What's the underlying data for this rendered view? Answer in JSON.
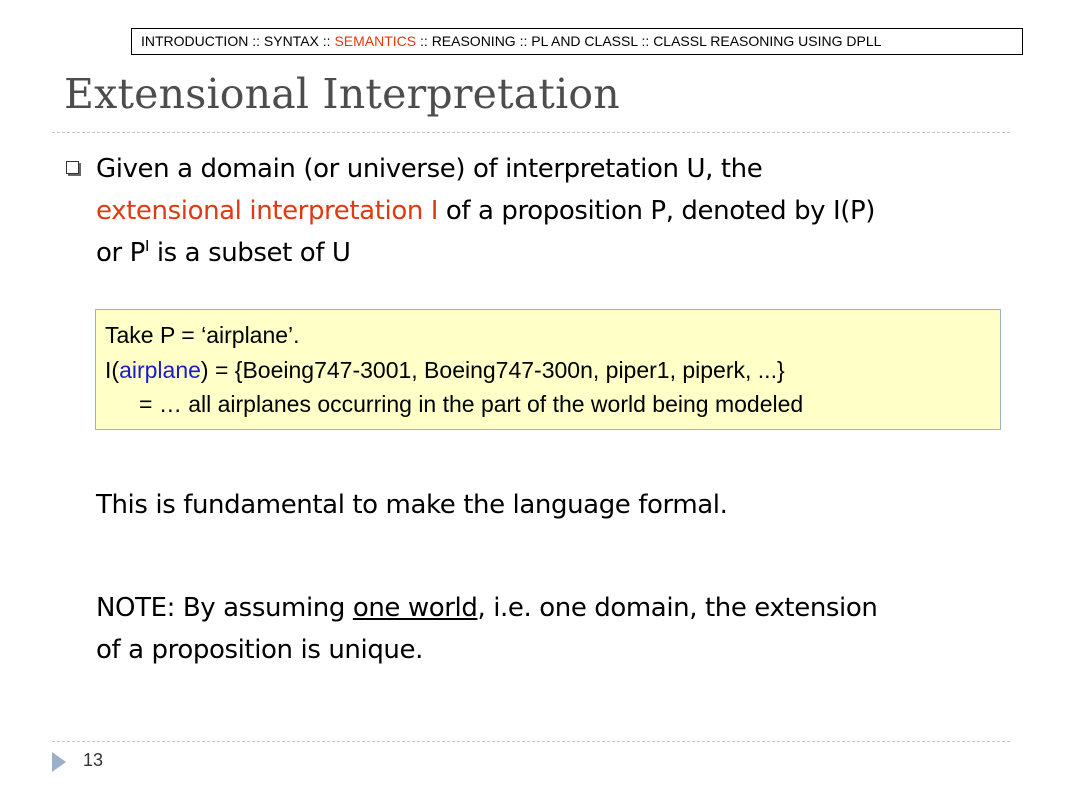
{
  "breadcrumb": {
    "introduction": "INTRODUCTION",
    "syntax": "SYNTAX",
    "semantics": "SEMANTICS",
    "reasoning": "REASONING",
    "pl_and_classl": "PL AND CLASSL",
    "classl_reasoning": "CLASSL REASONING USING DPLL",
    "separator": " :: ",
    "active_color": "#e03a10"
  },
  "slide": {
    "title": "Extensional Interpretation",
    "bullet_icon": "hollow-square-bullet",
    "bullet": {
      "part1": "Given a domain (or universe) of interpretation U, the",
      "highlight": "extensional interpretation I",
      "part2": " of a proposition P, denoted by I(P)",
      "part3_pre": "or P",
      "superscript": "I",
      "part3_post": " is a subset of U"
    },
    "example": {
      "line1": "Take P = ‘airplane’.",
      "line2_pre": "I(",
      "line2_term": "airplane",
      "line2_post": ") = {Boeing747-3001, Boeing747-300n, piper1, piperk, ...}",
      "line3": "= … all airplanes occurring in the part of the world being modeled"
    },
    "statement": "This is fundamental to make the language formal.",
    "note": {
      "pre": "NOTE:  By assuming ",
      "underlined": "one world",
      "post": ", i.e. one domain, the extension",
      "line2": "of a proposition is unique."
    }
  },
  "footer": {
    "page_number": "13",
    "arrow_icon": "page-arrow-icon"
  }
}
